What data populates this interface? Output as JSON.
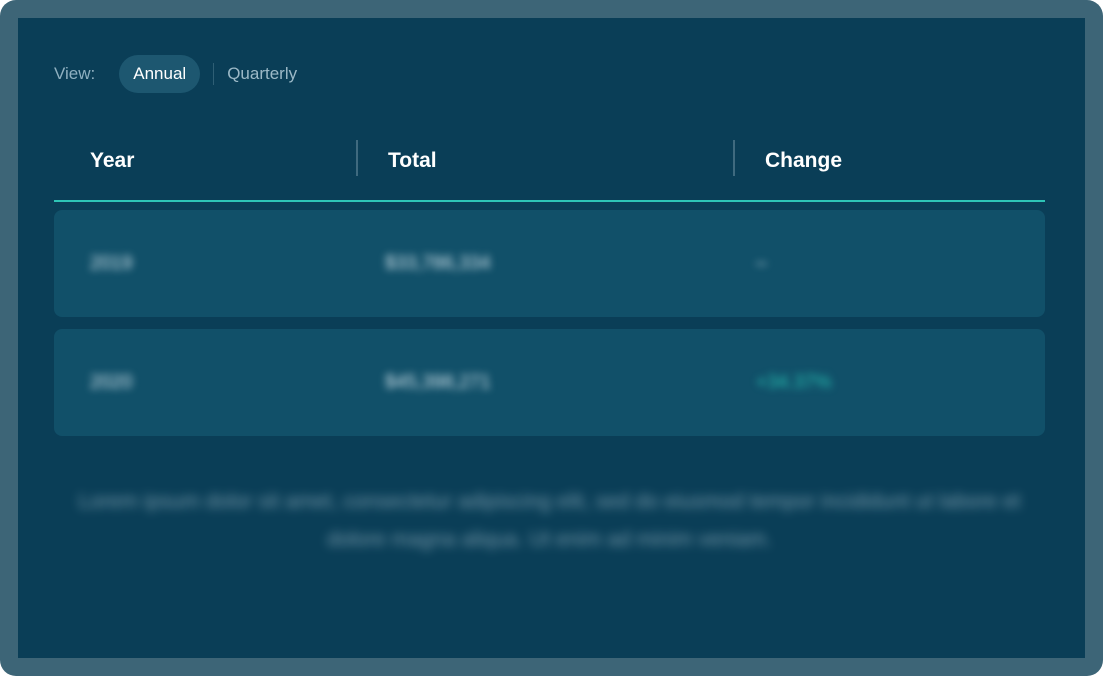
{
  "view": {
    "label": "View:",
    "options": [
      "Annual",
      "Quarterly"
    ],
    "selected": "Annual"
  },
  "table": {
    "columns": [
      "Year",
      "Total",
      "Change"
    ],
    "rows": [
      {
        "year": "2019",
        "total": "$33,786,334",
        "change": "–"
      },
      {
        "year": "2020",
        "total": "$45,398,271",
        "change": "+34.37%"
      }
    ]
  },
  "footnote": "Lorem ipsum dolor sit amet, consectetur adipiscing elit, sed do eiusmod tempor incididunt ut labore et dolore magna aliqua. Ut enim ad minim veniam.",
  "colors": {
    "frame": "#3d6577",
    "panel": "#0a3e57",
    "row": "#115069",
    "accent": "#2ec4b6"
  }
}
